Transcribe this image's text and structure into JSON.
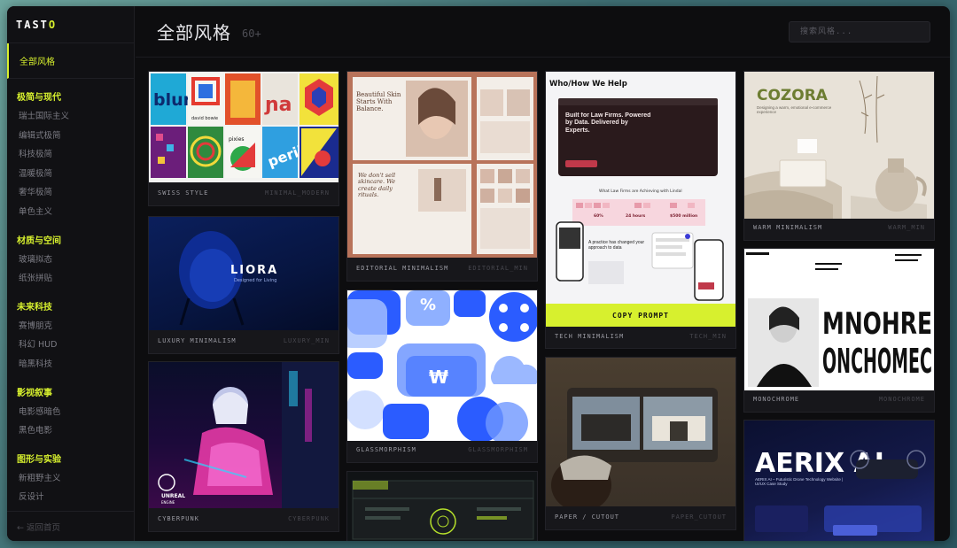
{
  "sidebar": {
    "logo_main": "TAST",
    "logo_accent": "O",
    "all_styles": "全部风格",
    "groups": [
      {
        "title": "极简与现代",
        "items": [
          "瑞士国际主义",
          "编辑式极简",
          "科技极简",
          "温暖极简",
          "奢华极简",
          "单色主义"
        ]
      },
      {
        "title": "材质与空间",
        "items": [
          "玻璃拟态",
          "纸张拼贴"
        ]
      },
      {
        "title": "未来科技",
        "items": [
          "赛博朋克",
          "科幻 HUD",
          "暗黑科技"
        ]
      },
      {
        "title": "影视叙事",
        "items": [
          "电影感暗色",
          "黑色电影"
        ]
      },
      {
        "title": "图形与实验",
        "items": [
          "新粗野主义",
          "反设计"
        ]
      }
    ],
    "back_home": "← 返回首页"
  },
  "header": {
    "title": "全部风格",
    "count": "60+",
    "search_placeholder": "搜索风格..."
  },
  "cards": {
    "swiss": {
      "name": "SWISS STYLE",
      "tag": "MINIMAL_MODERN",
      "thumb_words": [
        "blur",
        "david bowie",
        "pixies",
        "peril"
      ]
    },
    "luxury": {
      "name": "LUXURY MINIMALISM",
      "tag": "LUXURY_MIN",
      "brand": "LIORA",
      "brand_sub": "Designed for Living"
    },
    "cyberpunk": {
      "name": "CYBERPUNK",
      "tag": "CYBERPUNK",
      "engine_line1": "UNREAL",
      "engine_line2": "ENGINE"
    },
    "editorial": {
      "name": "EDITORIAL MINIMALISM",
      "tag": "EDITORIAL_MIN",
      "headline": "Beautiful Skin Starts With Balance.",
      "sub_headline": "We don't sell skincare. We create daily rituals."
    },
    "glass": {
      "name": "GLASSMORPHISM",
      "tag": "GLASSMORPHISM",
      "symbol_percent": "%",
      "symbol_won": "₩"
    },
    "tech": {
      "name": "TECH MINIMALISM",
      "tag": "TECH_MIN",
      "top_text": "Who/How We Help",
      "hero": "Built for Law Firms. Powered by Data. Delivered by Experts.",
      "section_title": "What Law Firms are Achieving with Lindal",
      "stat1": "60%",
      "stat2": "24 hours",
      "stat3": "$500 million",
      "card_text": "A practice has changed your approach to data",
      "copy_label": "COPY PROMPT"
    },
    "paper": {
      "name": "PAPER / CUTOUT",
      "tag": "PAPER_CUTOUT"
    },
    "warm": {
      "name": "WARM MINIMALISM",
      "tag": "WARM_MIN",
      "brand": "COZORA",
      "brand_sub": "Designing a warm, emotional e-commerce experience"
    },
    "mono": {
      "name": "MONOCHROME",
      "tag": "MONOCHROME",
      "big_text_1": "MNOHRE",
      "big_text_2": "ONCHOMEC"
    },
    "aerix": {
      "brand": "AERIX AI",
      "sub": "AERIX AI – Futuristic Drone Technology Website | UI/UX Case Study"
    }
  },
  "colors": {
    "accent": "#d7f02e",
    "background": "#0d0d0f",
    "sidebar": "#111114"
  }
}
